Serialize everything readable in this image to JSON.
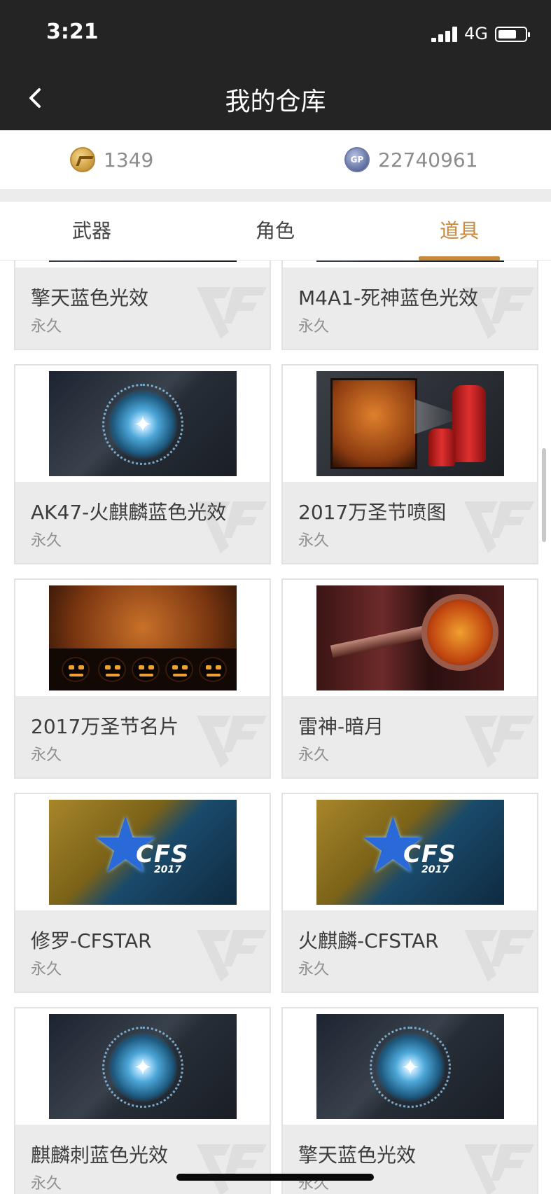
{
  "status_bar": {
    "time": "3:21",
    "network": "4G"
  },
  "nav": {
    "title": "我的仓库"
  },
  "currency": {
    "cf_points": "1349",
    "gp_icon_label": "GP",
    "gp_points": "22740961"
  },
  "tabs": [
    {
      "label": "武器",
      "active": false
    },
    {
      "label": "角色",
      "active": false
    },
    {
      "label": "道具",
      "active": true
    }
  ],
  "accent_color": "#c8893a",
  "items": [
    {
      "name": "擎天蓝色光效",
      "duration": "永久",
      "thumb": "blue-glow"
    },
    {
      "name": "M4A1-死神蓝色光效",
      "duration": "永久",
      "thumb": "blue-glow"
    },
    {
      "name": "AK47-火麒麟蓝色光效",
      "duration": "永久",
      "thumb": "blue-glow"
    },
    {
      "name": "2017万圣节喷图",
      "duration": "永久",
      "thumb": "halloween-spray"
    },
    {
      "name": "2017万圣节名片",
      "duration": "永久",
      "thumb": "halloween-card"
    },
    {
      "name": "雷神-暗月",
      "duration": "永久",
      "thumb": "dark-moon"
    },
    {
      "name": "修罗-CFSTAR",
      "duration": "永久",
      "thumb": "cfstar",
      "badge_text": "CFS",
      "badge_year": "2017"
    },
    {
      "name": "火麒麟-CFSTAR",
      "duration": "永久",
      "thumb": "cfstar",
      "badge_text": "CFS",
      "badge_year": "2017"
    },
    {
      "name": "麒麟刺蓝色光效",
      "duration": "永久",
      "thumb": "blue-glow"
    },
    {
      "name": "擎天蓝色光效",
      "duration": "永久",
      "thumb": "blue-glow"
    }
  ]
}
